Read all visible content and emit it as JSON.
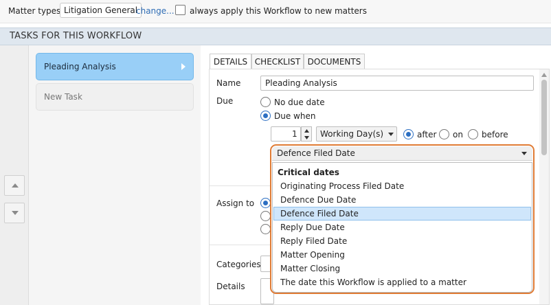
{
  "topbar": {
    "matter_types_label": "Matter types:",
    "matter_type_value": "Litigation General",
    "change_link": "change...",
    "always_apply_label": "always apply this Workflow to new matters"
  },
  "section": {
    "title": "TASKS FOR THIS WORKFLOW"
  },
  "tasks": [
    {
      "label": "Pleading Analysis",
      "active": true
    },
    {
      "label": "New Task",
      "active": false
    }
  ],
  "tabs": [
    {
      "label": "DETAILS",
      "selected": true
    },
    {
      "label": "CHECKLIST",
      "selected": false
    },
    {
      "label": "DOCUMENTS",
      "selected": false
    }
  ],
  "details": {
    "name_label": "Name",
    "name_value": "Pleading Analysis",
    "due_label": "Due",
    "no_due_date": "No due date",
    "due_when": "Due when",
    "due_amount": "1",
    "due_unit": "Working Day(s)",
    "after": "after",
    "on": "on",
    "before": "before",
    "assign_label": "Assign to",
    "categories_label": "Categories",
    "details_label": "Details"
  },
  "dropdown": {
    "selected": "Defence Filed Date",
    "group": "Critical dates",
    "options": [
      "Originating Process Filed Date",
      "Defence Due Date",
      "Defence Filed Date",
      "Reply Due Date",
      "Reply Filed Date",
      "Matter Opening",
      "Matter Closing",
      "The date this Workflow is applied to a matter"
    ],
    "highlighted_index": 2
  },
  "colors": {
    "accent": "#2c6fc2",
    "task_active": "#99cff7",
    "dropdown_border": "#e07b34",
    "highlight": "#cfe6fb"
  }
}
